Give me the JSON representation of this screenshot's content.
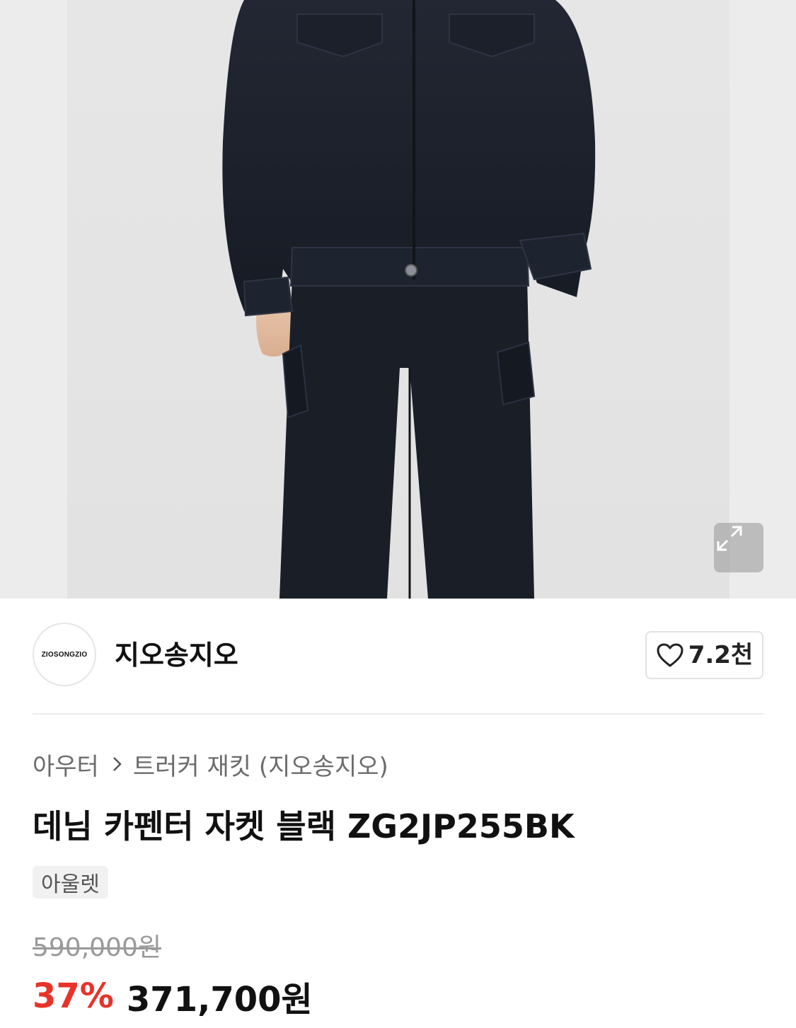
{
  "product_image": {
    "alt": "",
    "expand_icon": "expand-arrows-icon"
  },
  "brand": {
    "logo_text": "ZIOSONGZIO",
    "name": "지오송지오",
    "like_icon": "heart-icon",
    "like_count": "7.2천"
  },
  "breadcrumb": {
    "category": "아우터",
    "separator_icon": "chevron-right-icon",
    "subcategory": "트러커 재킷 (지오송지오)"
  },
  "product": {
    "title": "데님 카펜터 자켓 블랙 ZG2JP255BK",
    "tag": "아울렛"
  },
  "price": {
    "original": "590,000원",
    "discount": "37%",
    "sale": "371,700원"
  },
  "colors": {
    "discount": "#e8332a",
    "denim": "#1b1f28"
  }
}
